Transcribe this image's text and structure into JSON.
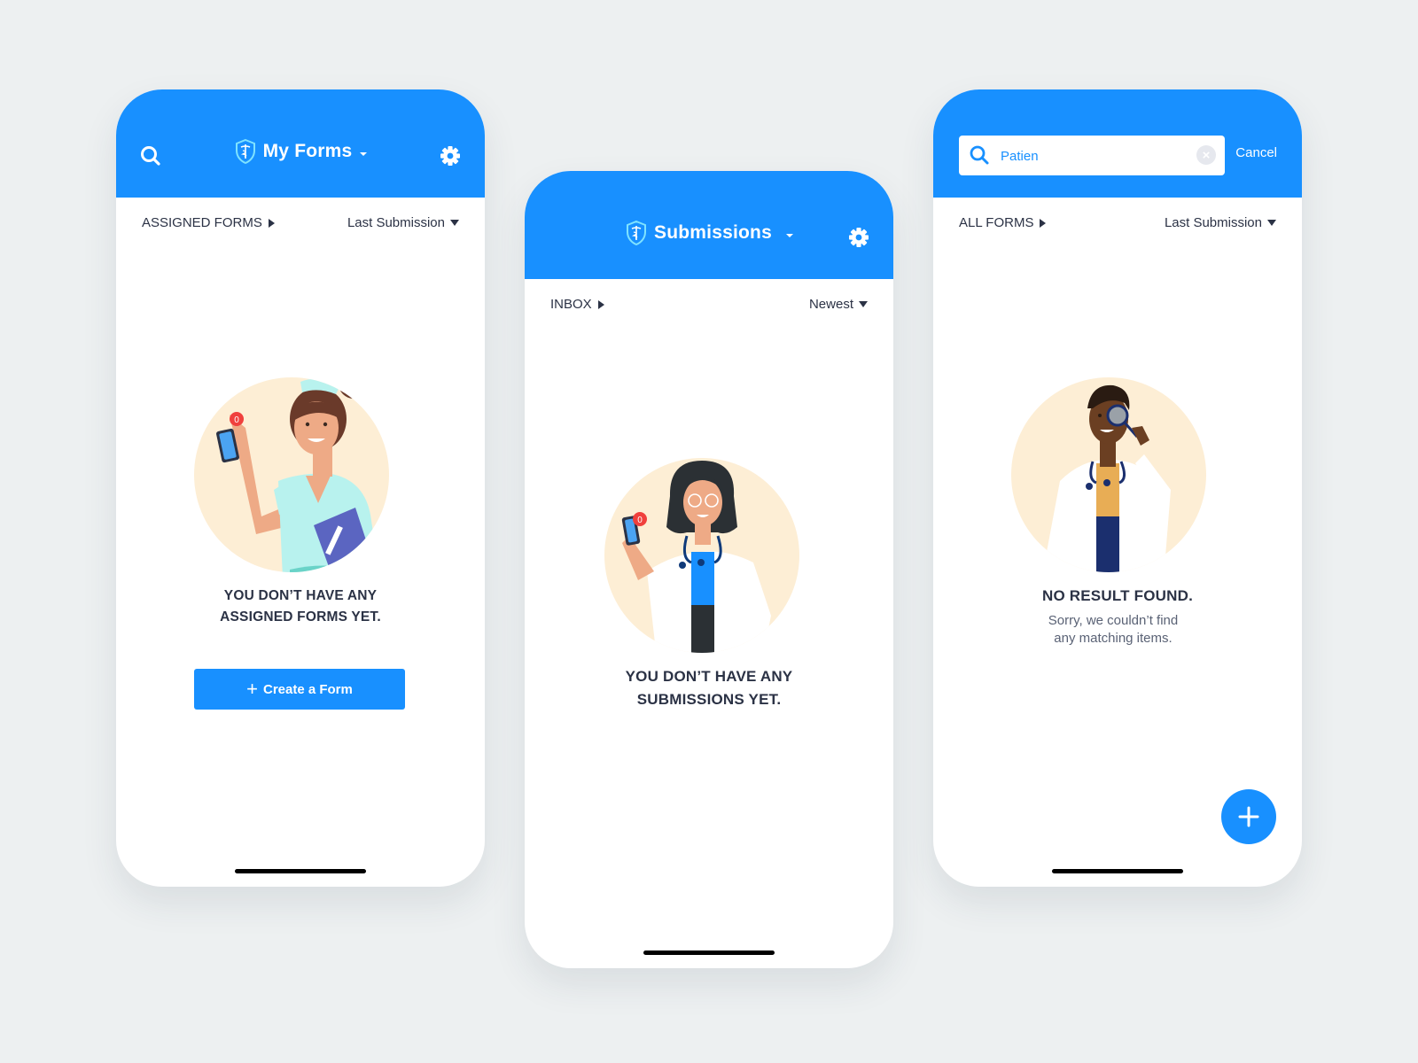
{
  "colors": {
    "brand_blue": "#1890ff",
    "background": "#edf0f1",
    "text_dark": "#2b3245",
    "illustration_bg": "#fdeed5",
    "badge_red": "#f0403d"
  },
  "screens": [
    {
      "header": {
        "title": "My Forms",
        "left_icon": "search-icon",
        "logo_icon": "shield-caduceus-icon",
        "right_icon": "gear-icon"
      },
      "subbar": {
        "filter_label": "ASSIGNED FORMS",
        "sort_label": "Last Submission"
      },
      "illustration": {
        "subject": "nurse-with-phone",
        "badge_count": "0"
      },
      "empty_state": {
        "title_line1": "YOU DON’T HAVE ANY",
        "title_line2": "ASSIGNED FORMS YET."
      },
      "primary_button": {
        "label": "Create a Form",
        "icon": "plus-icon"
      }
    },
    {
      "header": {
        "title": "Submissions",
        "logo_icon": "shield-caduceus-icon",
        "right_icon": "gear-icon"
      },
      "subbar": {
        "filter_label": "INBOX",
        "sort_label": "Newest"
      },
      "illustration": {
        "subject": "doctor-with-phone",
        "badge_count": "0"
      },
      "empty_state": {
        "title_line1": "YOU DON’T HAVE ANY",
        "title_line2": "SUBMISSIONS YET."
      }
    },
    {
      "header": {
        "search_value": "Patien",
        "search_icon": "search-icon",
        "clear_icon": "clear-icon",
        "cancel_label": "Cancel"
      },
      "subbar": {
        "filter_label": "ALL FORMS",
        "sort_label": "Last Submission"
      },
      "illustration": {
        "subject": "doctor-with-magnifier"
      },
      "empty_state": {
        "title": "NO RESULT FOUND.",
        "sub_line1": "Sorry, we couldn’t find",
        "sub_line2": "any matching items."
      },
      "fab": {
        "icon": "plus-icon"
      }
    }
  ]
}
